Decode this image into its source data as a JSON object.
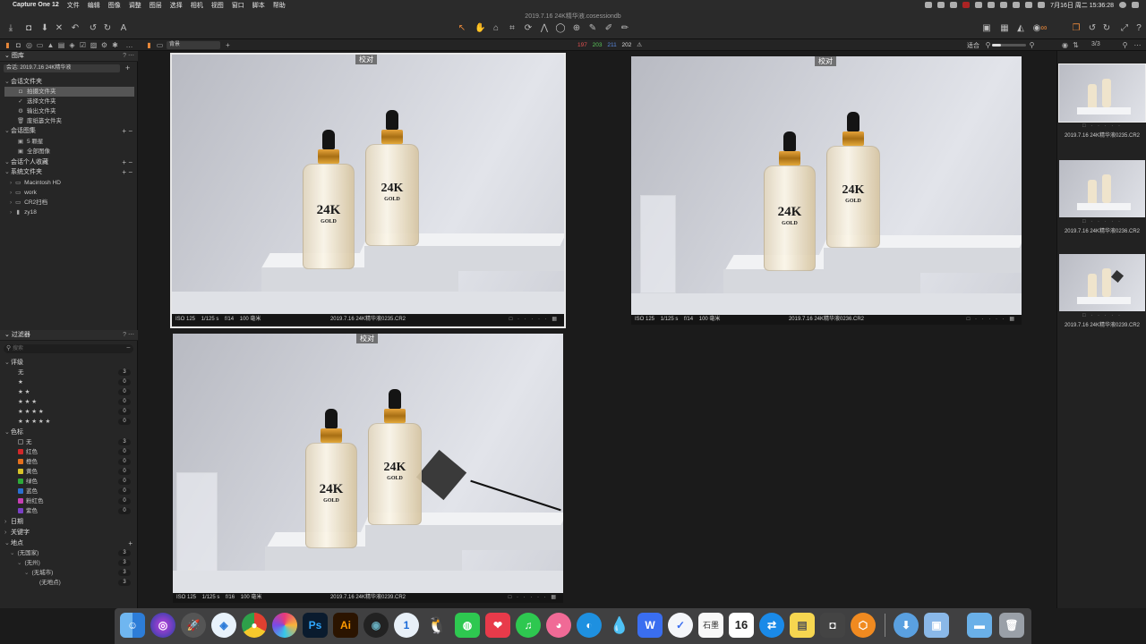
{
  "menubar": {
    "app": "Capture One 12",
    "menus": [
      "文件",
      "编辑",
      "图像",
      "调整",
      "图层",
      "选择",
      "相机",
      "视图",
      "窗口",
      "脚本",
      "帮助"
    ],
    "clock": "7月16日 周二  15:36:28"
  },
  "toolbar": {
    "document_title": "2019.7.16 24K精华液.cosessiondb"
  },
  "subbar": {
    "set_select": "背景",
    "count_red": "197",
    "count_green": "203",
    "count_blue": "211",
    "count_white": "202",
    "fit_label": "适合",
    "page_count": "3/3"
  },
  "library": {
    "title": "图库",
    "session_select": "会话: 2019.7.16 24K精华液",
    "session_folders_header": "会话文件夹",
    "session_folders": [
      "拍摄文件夹",
      "选择文件夹",
      "输出文件夹",
      "废纸篓文件夹"
    ],
    "session_albums_header": "会话图集",
    "session_albums": [
      "5 颗星",
      "全部图像"
    ],
    "favorites_header": "会话个人收藏",
    "system_folders_header": "系统文件夹",
    "system_folders": [
      "Macintosh HD",
      "work",
      "CR2扫档",
      "zy18"
    ]
  },
  "filters": {
    "title": "过滤器",
    "search_placeholder": "搜索",
    "rating_header": "评级",
    "ratings": [
      {
        "label": "无",
        "count": "3"
      },
      {
        "label": "★",
        "count": "0"
      },
      {
        "label": "★ ★",
        "count": "0"
      },
      {
        "label": "★ ★ ★",
        "count": "0"
      },
      {
        "label": "★ ★ ★ ★",
        "count": "0"
      },
      {
        "label": "★ ★ ★ ★ ★",
        "count": "0"
      }
    ],
    "color_header": "色标",
    "colors": [
      {
        "label": "无",
        "count": "3",
        "color": "#2a2a2a"
      },
      {
        "label": "红色",
        "count": "0",
        "color": "#d0282a"
      },
      {
        "label": "橙色",
        "count": "0",
        "color": "#e36f1e"
      },
      {
        "label": "黄色",
        "count": "0",
        "color": "#d8c22a"
      },
      {
        "label": "绿色",
        "count": "0",
        "color": "#2eaa3a"
      },
      {
        "label": "蓝色",
        "count": "0",
        "color": "#2a6fd0"
      },
      {
        "label": "粉红色",
        "count": "0",
        "color": "#c63fb3"
      },
      {
        "label": "紫色",
        "count": "0",
        "color": "#7a3fc6"
      }
    ],
    "date_header": "日期",
    "keyword_header": "关键字",
    "place_header": "地点",
    "places": [
      {
        "label": "(无国家)",
        "count": "3"
      },
      {
        "label": "(无州)",
        "count": "3"
      },
      {
        "label": "(无城市)",
        "count": "3"
      },
      {
        "label": "(无地点)",
        "count": "3"
      }
    ]
  },
  "viewer": {
    "proof_tag": "校对",
    "photos": [
      {
        "iso": "ISO 125",
        "shutter": "1/125 s",
        "aperture": "f/14",
        "focal": "100 毫米",
        "file": "2019.7.16 24K精华液0235.CR2"
      },
      {
        "iso": "ISO 125",
        "shutter": "1/125 s",
        "aperture": "f/14",
        "focal": "100 毫米",
        "file": "2019.7.16 24K精华液0236.CR2"
      },
      {
        "iso": "ISO 125",
        "shutter": "1/125 s",
        "aperture": "f/16",
        "focal": "100 毫米",
        "file": "2019.7.16 24K精华液0239.CR2"
      }
    ],
    "bottle_text": {
      "big": "24K",
      "gold": "GOLD"
    }
  },
  "browser": {
    "thumbs": [
      "2019.7.16 24K精华液0235.CR2",
      "2019.7.16 24K精华液0236.CR2",
      "2019.7.16 24K精华液0239.CR2"
    ]
  },
  "dock": {
    "apps": [
      "Finder",
      "Siri",
      "Launchpad",
      "Safari",
      "Chrome",
      "Pinwheel",
      "Ps",
      "Ai",
      "C4D",
      "1Password",
      "QQ",
      "WeChat",
      "Pocket",
      "Music",
      "Bilibili",
      "Browser",
      "Pages",
      "WPS",
      "TickTick",
      "石墨",
      "Calendar",
      "TeamViewer",
      "Stickies",
      "Screenshot",
      "Migrate",
      "Downloads",
      "Preview",
      "Folder",
      "Trash"
    ],
    "calendar_date": "16",
    "shimo_text": "石墨"
  }
}
